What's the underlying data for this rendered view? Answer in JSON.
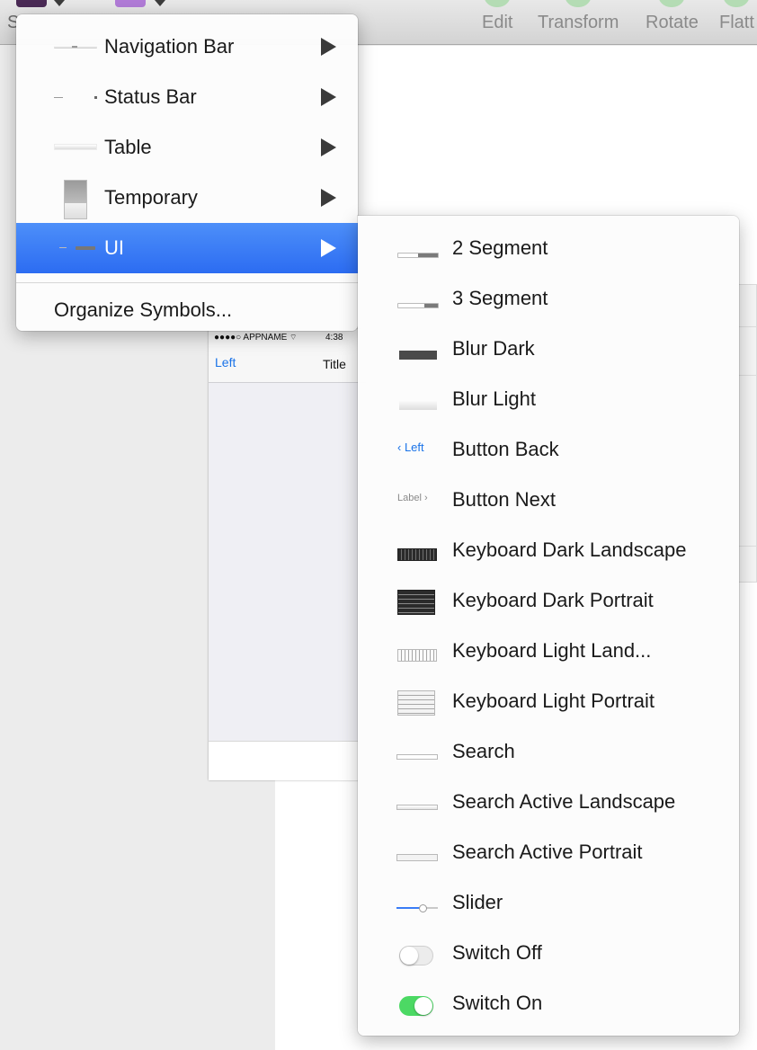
{
  "toolbar": {
    "left_label": "S",
    "items": [
      "Edit",
      "Transform",
      "Rotate",
      "Flatt"
    ]
  },
  "artboard": {
    "status_left": "●●●●○ APPNAME ",
    "wifi_icon": "wifi-icon",
    "status_time": "4:38",
    "nav_left": "Left",
    "nav_title": "Title"
  },
  "symbols_menu": {
    "items": [
      {
        "label": "Navigation Bar",
        "icon": "navigation-bar-thumbnail-icon"
      },
      {
        "label": "Status Bar",
        "icon": "status-bar-thumbnail-icon"
      },
      {
        "label": "Table",
        "icon": "table-thumbnail-icon"
      },
      {
        "label": "Temporary",
        "icon": "temporary-thumbnail-icon"
      },
      {
        "label": "UI",
        "icon": "ui-thumbnail-icon",
        "selected": true
      }
    ],
    "organize_label": "Organize Symbols..."
  },
  "ui_submenu": {
    "items": [
      {
        "label": "2 Segment",
        "icon": "two-segment-icon"
      },
      {
        "label": "3 Segment",
        "icon": "three-segment-icon"
      },
      {
        "label": "Blur Dark",
        "icon": "blur-dark-icon"
      },
      {
        "label": "Blur Light",
        "icon": "blur-light-icon"
      },
      {
        "label": "Button Back",
        "icon": "button-back-icon",
        "preview": "Left"
      },
      {
        "label": "Button Next",
        "icon": "button-next-icon",
        "preview": "Label"
      },
      {
        "label": "Keyboard Dark Landscape",
        "icon": "keyboard-dark-landscape-icon"
      },
      {
        "label": "Keyboard Dark Portrait",
        "icon": "keyboard-dark-portrait-icon"
      },
      {
        "label": "Keyboard Light Land...",
        "icon": "keyboard-light-landscape-icon"
      },
      {
        "label": "Keyboard Light Portrait",
        "icon": "keyboard-light-portrait-icon"
      },
      {
        "label": "Search",
        "icon": "search-bar-icon"
      },
      {
        "label": "Search Active Landscape",
        "icon": "search-active-landscape-icon"
      },
      {
        "label": "Search Active Portrait",
        "icon": "search-active-portrait-icon"
      },
      {
        "label": "Slider",
        "icon": "slider-icon"
      },
      {
        "label": "Switch Off",
        "icon": "switch-off-icon"
      },
      {
        "label": "Switch On",
        "icon": "switch-on-icon"
      }
    ]
  },
  "colors": {
    "selection_blue": "#2c6cf2",
    "link_blue": "#1a73e8",
    "switch_green": "#4cd964"
  }
}
